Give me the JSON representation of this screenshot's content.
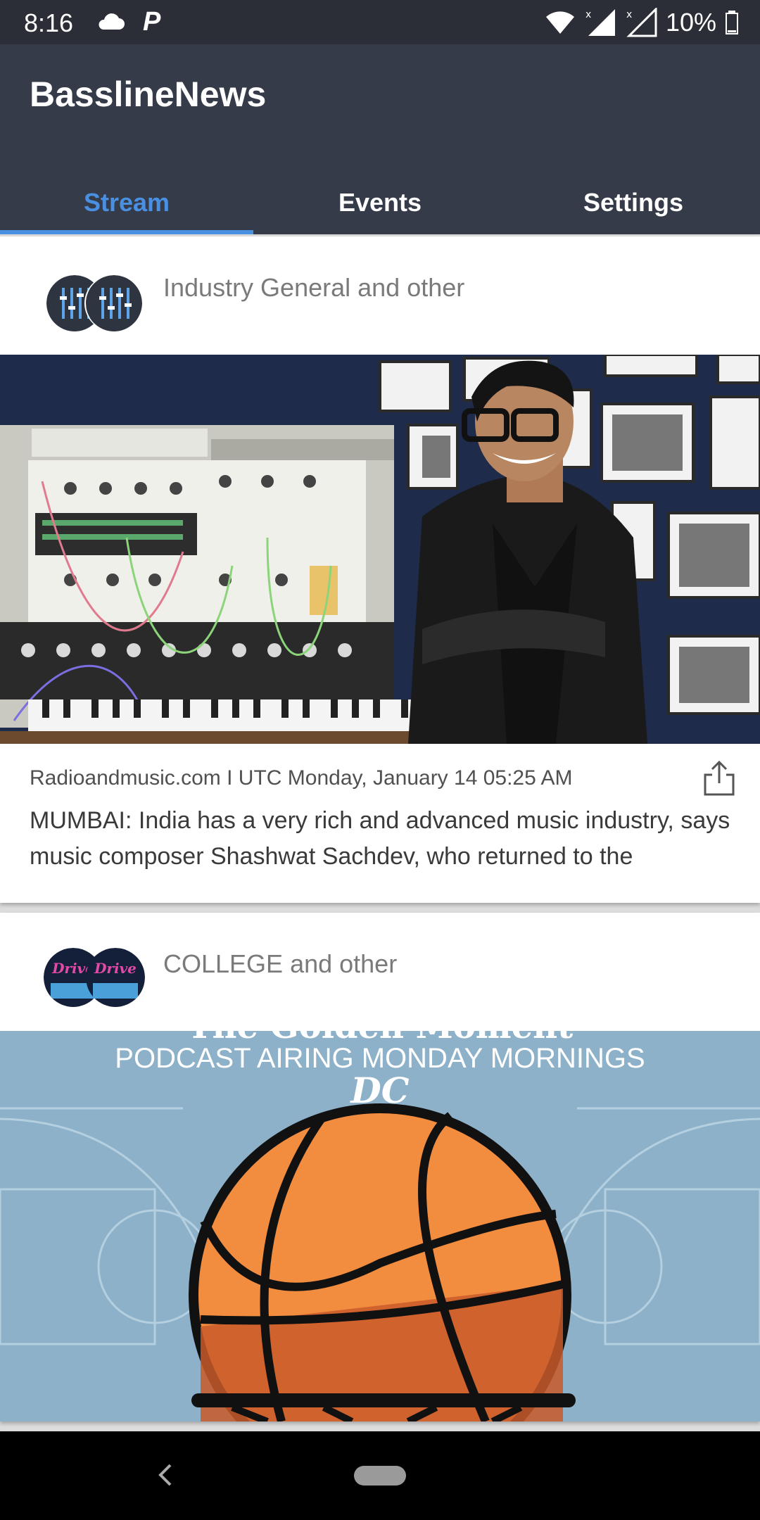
{
  "status_bar": {
    "time": "8:16",
    "battery_text": "10%",
    "icons": [
      "cloud-icon",
      "parking-p-icon",
      "wifi-icon",
      "signal-icon",
      "signal-icon",
      "battery-icon"
    ]
  },
  "app": {
    "title": "BasslineNews"
  },
  "tabs": [
    {
      "label": "Stream",
      "active": true
    },
    {
      "label": "Events",
      "active": false
    },
    {
      "label": "Settings",
      "active": false
    }
  ],
  "feed": {
    "cards": [
      {
        "source": "Industry General and other",
        "image_alt": "Musician in leather jacket standing in front of a modular synthesizer",
        "meta": "Radioandmusic.com I UTC Monday, January 14 05:25 AM",
        "excerpt": "MUMBAI: India has a very rich and advanced music industry, says music composer Shashwat Sachdev, who returned to the"
      },
      {
        "source": "COLLEGE and other",
        "image_text": "PODCAST AIRING MONDAY MORNINGS",
        "image_logo": "DC"
      }
    ]
  },
  "colors": {
    "status_bar": "#2b2e36",
    "app_bar": "#353b48",
    "accent": "#4a90e2",
    "basketball": "#f28c3f",
    "court": "#8db1c9"
  }
}
